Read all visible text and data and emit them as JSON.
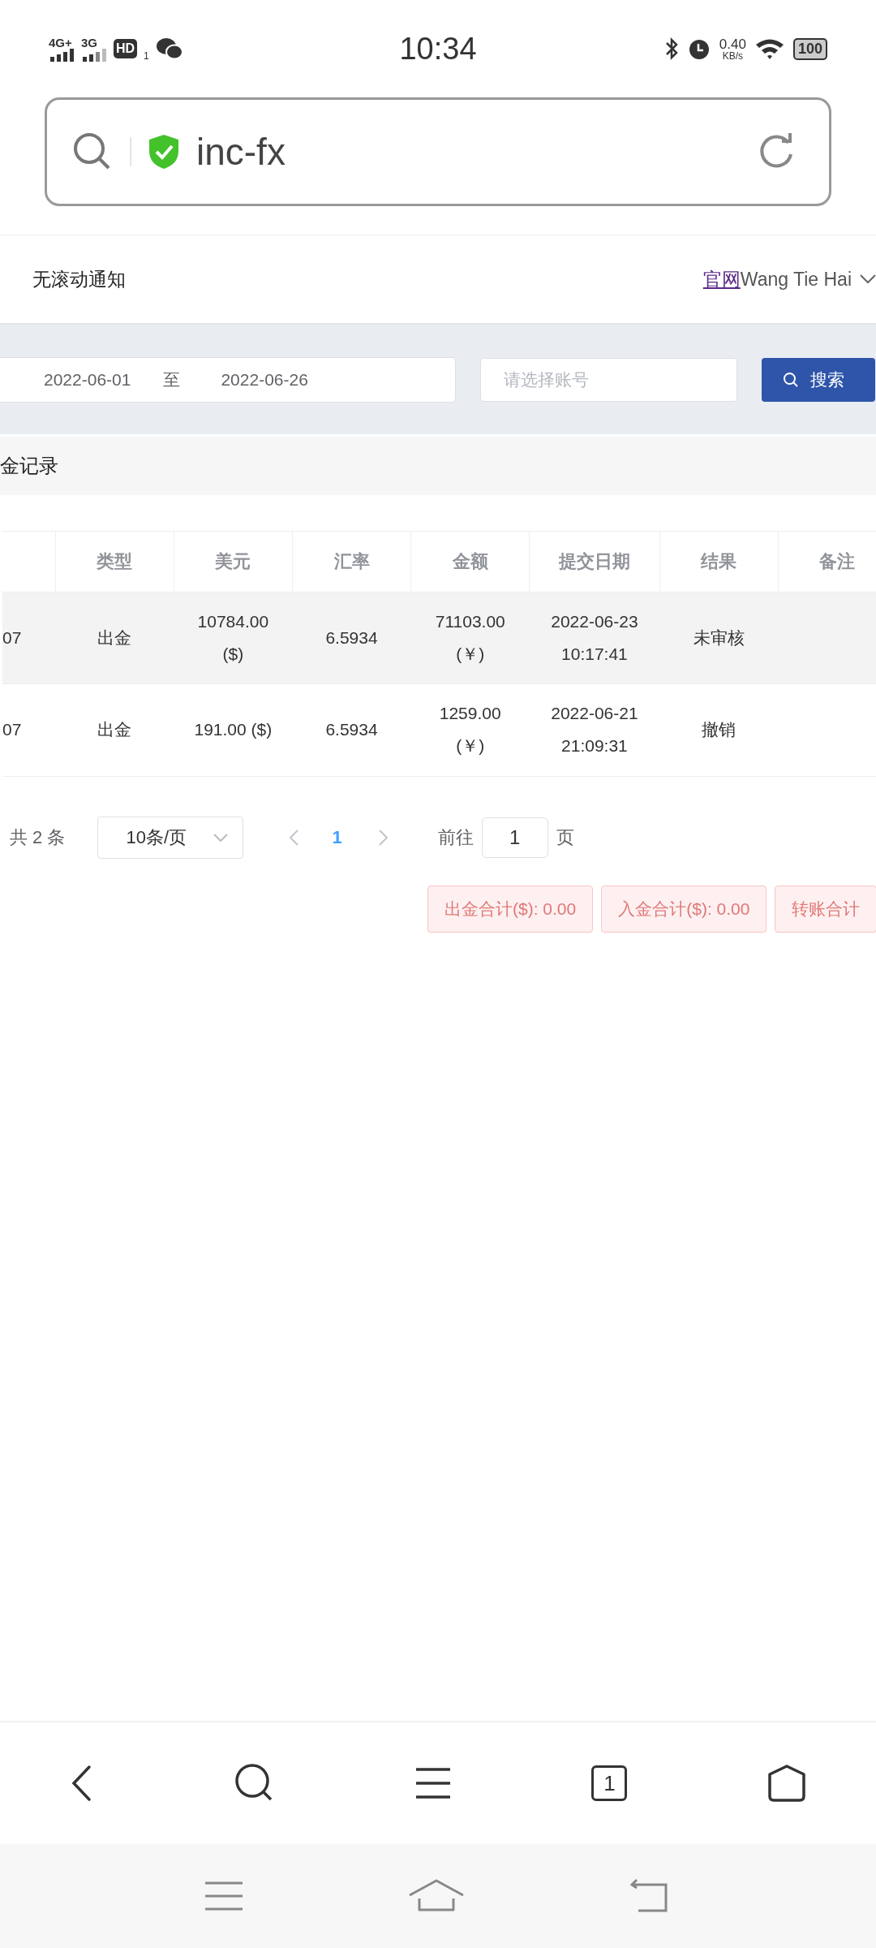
{
  "status_bar": {
    "network_1": "4G+",
    "network_2": "3G",
    "hd_badge": "HD",
    "hd_sim": "1",
    "time": "10:34",
    "speed_value": "0.40",
    "speed_unit": "KB/s",
    "battery": "100"
  },
  "address_bar": {
    "url": "inc-fx"
  },
  "header": {
    "notice": "无滚动通知",
    "link": "官网",
    "user": "Wang Tie Hai"
  },
  "filters": {
    "date_from": "2022-06-01",
    "separator": "至",
    "date_to": "2022-06-26",
    "account_placeholder": "请选择账号",
    "search_button": "搜索"
  },
  "section_title": "金记录",
  "table": {
    "columns": [
      "",
      "类型",
      "美元",
      "汇率",
      "金额",
      "提交日期",
      "结果",
      "备注"
    ],
    "rows": [
      {
        "highlighted": true,
        "cells": [
          "07",
          "出金",
          "10784.00 ($)",
          "6.5934",
          "71103.00 (￥)",
          "2022-06-23 10:17:41",
          "未审核"
        ]
      },
      {
        "highlighted": false,
        "cells": [
          "07",
          "出金",
          "191.00 ($)",
          "6.5934",
          "1259.00 (￥)",
          "2022-06-21 21:09:31",
          "撤销"
        ]
      }
    ]
  },
  "pagination": {
    "total": "共 2 条",
    "page_size": "10条/页",
    "pages": [
      {
        "label": "1",
        "selected": true
      }
    ],
    "goto_label": "前往",
    "goto_value": "1",
    "page_suffix": "页"
  },
  "totals": [
    "出金合计($): 0.00",
    "入金合计($): 0.00",
    "转账合计"
  ],
  "browser_nav": {
    "tab_count": "1"
  }
}
